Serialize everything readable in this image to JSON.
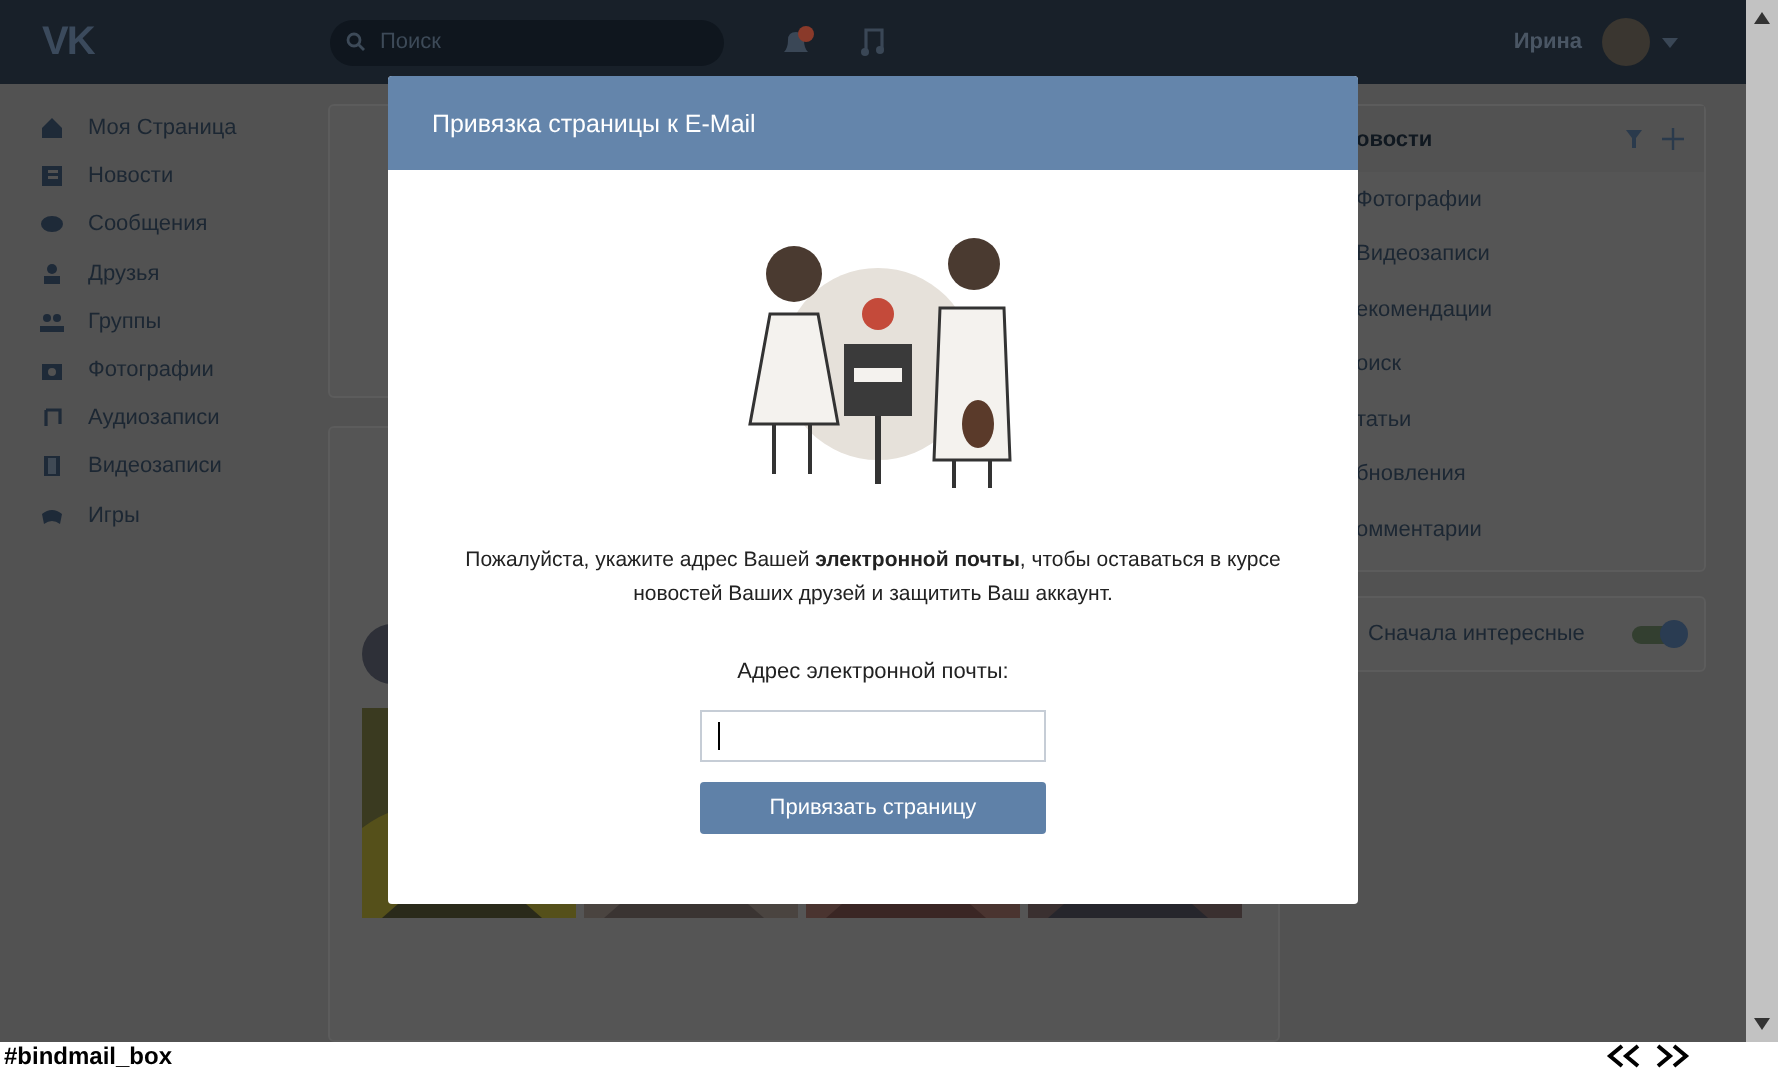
{
  "header": {
    "logo": "VK",
    "search": {
      "placeholder": "Поиск"
    },
    "user_name": "Ирина"
  },
  "sidebar": {
    "items": [
      {
        "label": "Моя Страница"
      },
      {
        "label": "Новости"
      },
      {
        "label": "Сообщения"
      },
      {
        "label": "Друзья"
      },
      {
        "label": "Группы"
      },
      {
        "label": "Фотографии"
      },
      {
        "label": "Аудиозаписи"
      },
      {
        "label": "Видеозаписи"
      },
      {
        "label": "Игры"
      }
    ]
  },
  "news_menu": {
    "title": "овости",
    "items": [
      "Фотографии",
      "Видеозаписи",
      "екомендации",
      "оиск",
      "татьи",
      "бновления",
      "омментарии"
    ]
  },
  "interesting_toggle": {
    "label": "Сначала интересные",
    "on": true
  },
  "modal": {
    "title": "Привязка страницы к E-Mail",
    "message": "Пожалуйста, укажите адрес Вашей **электронной почты**, чтобы оставаться в курсе новостей Ваших друзей и защитить Ваш аккаунт.",
    "email_label": "Адрес электронной почты:",
    "button": "Привязать страницу"
  },
  "status_bar": {
    "text": "#bindmail_box"
  }
}
